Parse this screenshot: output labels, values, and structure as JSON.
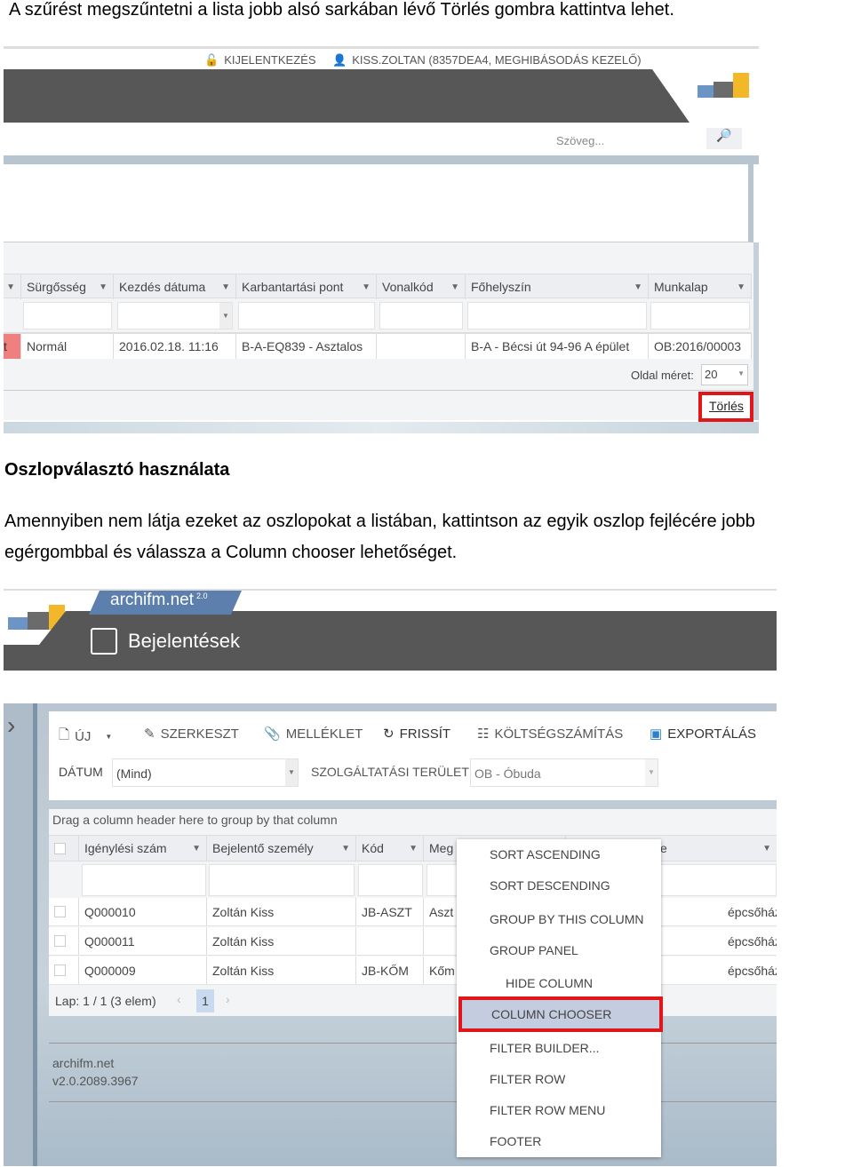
{
  "intro_text": "A szűrést megszűntetni a lista jobb alsó sarkában lévő Törlés gombra kattintva lehet.",
  "shot1": {
    "logout": "KIJELENTKEZÉS",
    "user": "KISS.ZOLTAN (8357DEA4, MEGHIBÁSODÁS KEZELŐ)",
    "search_placeholder": "Szöveg...",
    "columns": [
      "Sürgősség",
      "Kezdés dátuma",
      "Karbantartási pont",
      "Vonalkód",
      "Főhelyszín",
      "Munkalap"
    ],
    "row": {
      "prefix": "t",
      "cells": [
        "Normál",
        "2016.02.18. 11:16",
        "B-A-EQ839 - Asztalos",
        "",
        "B-A - Bécsi út 94-96 A épület",
        "OB:2016/00003"
      ]
    },
    "page_size_label": "Oldal méret:",
    "page_size": "20",
    "clear_button": "Törlés",
    "highlight_color": "#e0161b"
  },
  "heading": "Oszlopválasztó használata",
  "paragraph": [
    "Amennyiben nem látja ezeket az oszlopokat a listában, kattintson az egyik oszlop fejlécére jobb",
    "egérgombbal és válassza a Column chooser lehetőséget."
  ],
  "shot2": {
    "brand": "archifm.net",
    "brand_version": "2.0",
    "page_title": "Bejelentések",
    "toolbar": [
      "ÚJ",
      "SZERKESZT",
      "MELLÉKLET",
      "FRISSÍT",
      "KÖLTSÉGSZÁMÍTÁS",
      "EXPORTÁLÁS"
    ],
    "date_label": "DÁTUM",
    "date_value": "(Mind)",
    "area_label": "SZOLGÁLTATÁSI TERÜLET",
    "area_value": "OB - Óbuda",
    "group_hint": "Drag a column header here to group by that column",
    "columns": [
      "Igénylési szám",
      "Bejelentő személy",
      "Kód",
      "Meg",
      "e"
    ],
    "rows": [
      {
        "id": "Q000010",
        "person": "Zoltán Kiss",
        "code": "JB-ASZT",
        "desc": "Aszt",
        "loc": "épcsőház"
      },
      {
        "id": "Q000011",
        "person": "Zoltán Kiss",
        "code": "",
        "desc": "",
        "loc": "épcsőház"
      },
      {
        "id": "Q000009",
        "person": "Zoltán Kiss",
        "code": "JB-KŐM",
        "desc": "Kőm",
        "loc": "épcsőház Aula felé"
      }
    ],
    "pager_text": "Lap: 1 / 1 (3 elem)",
    "current_page": "1",
    "footer_name": "archifm.net",
    "footer_version": "v2.0.2089.3967",
    "context_menu": [
      "SORT ASCENDING",
      "SORT DESCENDING",
      "GROUP BY THIS COLUMN",
      "GROUP PANEL",
      "HIDE COLUMN",
      "COLUMN CHOOSER",
      "FILTER BUILDER...",
      "FILTER ROW",
      "FILTER ROW MENU",
      "FOOTER"
    ],
    "highlighted_item": "COLUMN CHOOSER"
  }
}
